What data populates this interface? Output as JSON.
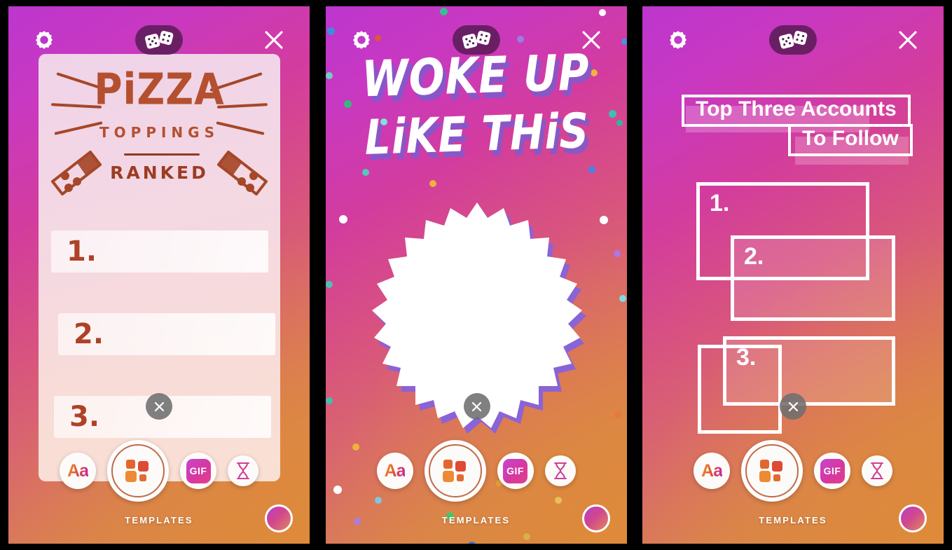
{
  "app": {
    "toolbar_label": "TEMPLATES",
    "icons": {
      "gear": "gear-icon",
      "dice": "dice-icon",
      "close": "close-icon",
      "text": "Aa",
      "gif": "GIF",
      "hourglass": "hourglass-icon",
      "templates": "templates-icon",
      "delete": "close-icon",
      "shutter": "shutter-button"
    },
    "colors": {
      "bg_start": "#bc36ce",
      "bg_mid": "#d8537f",
      "bg_end": "#d1893c",
      "dice_pill": "#541a52",
      "card_brown": "#b4502f",
      "accent_white": "#ffffff",
      "delete_gray": "#6e6e6e"
    }
  },
  "panels": [
    {
      "id": "panel-pizza",
      "template_name": "Pizza Toppings Ranked",
      "card": {
        "title": "PiZZA",
        "subtitle": "TOPPINGS",
        "footer": "RANKED"
      },
      "rows": [
        {
          "number": "1."
        },
        {
          "number": "2."
        },
        {
          "number": "3."
        }
      ]
    },
    {
      "id": "panel-woke",
      "template_name": "Woke Up Like This",
      "headline_line1": "WOKE UP",
      "headline_line2": "LiKE THiS",
      "badge": "starburst-badge"
    },
    {
      "id": "panel-accounts",
      "template_name": "Top Three Accounts To Follow",
      "headline_line1": "Top Three Accounts",
      "headline_line2": "To Follow",
      "boxes": [
        {
          "number": "1."
        },
        {
          "number": "2."
        },
        {
          "number": "3."
        }
      ]
    }
  ]
}
